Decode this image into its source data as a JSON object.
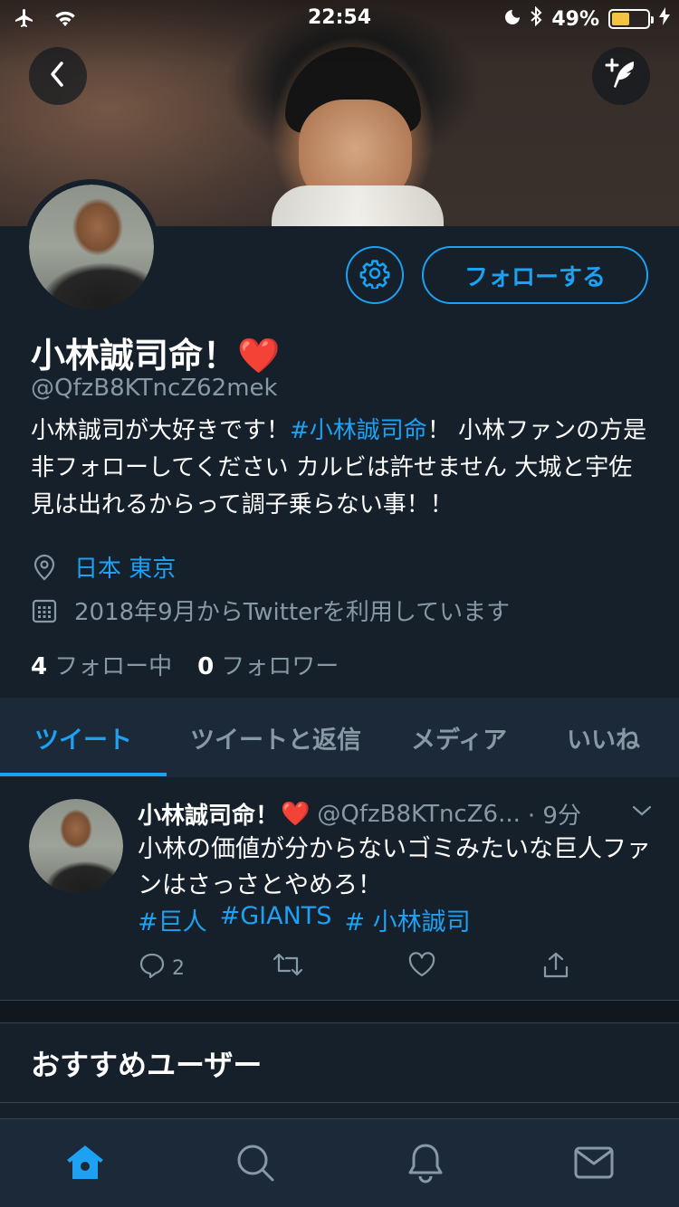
{
  "status_bar": {
    "time": "22:54",
    "battery_percent": "49%",
    "battery_level": 0.49,
    "icons": [
      "airplane-icon",
      "wifi-icon",
      "moon-icon",
      "bluetooth-icon",
      "battery-icon",
      "charging-icon"
    ]
  },
  "header": {
    "back_icon": "chevron-left-icon",
    "compose_icon": "compose-tweet-icon"
  },
  "profile": {
    "display_name": "小林誠司命！",
    "name_emoji": "❤️",
    "handle": "@QfzB8KTncZ62mek",
    "bio_parts": {
      "part1": "小林誠司が大好きです！",
      "hashtag": "#小林誠司命",
      "part2": "！ 小林ファンの方是非フォローしてください カルビは許せません 大城と宇佐見は出れるからって調子乗らない事！！"
    },
    "location": "日本 東京",
    "joined": "2018年9月からTwitterを利用しています",
    "following_count": "4",
    "following_label": "フォロー中",
    "followers_count": "0",
    "followers_label": "フォロワー",
    "follow_button": "フォローする"
  },
  "tabs": [
    {
      "label": "ツイート",
      "active": true
    },
    {
      "label": "ツイートと返信",
      "active": false
    },
    {
      "label": "メディア",
      "active": false
    },
    {
      "label": "いいね",
      "active": false
    }
  ],
  "tweet": {
    "name": "小林誠司命！",
    "emoji": "❤️",
    "handle": "@QfzB8KTncZ6...",
    "time": "· 9分",
    "text": "小林の価値が分からないゴミみたいな巨人ファンはさっさとやめろ！",
    "hashtags": [
      "#巨人",
      "#GIANTS",
      "# 小林誠司"
    ],
    "reply_count": "2"
  },
  "recommend_title": "おすすめユーザー",
  "colors": {
    "background": "#15202b",
    "accent": "#1da1f2",
    "secondary_text": "#8899a6",
    "tab_bar": "#1c2938"
  }
}
